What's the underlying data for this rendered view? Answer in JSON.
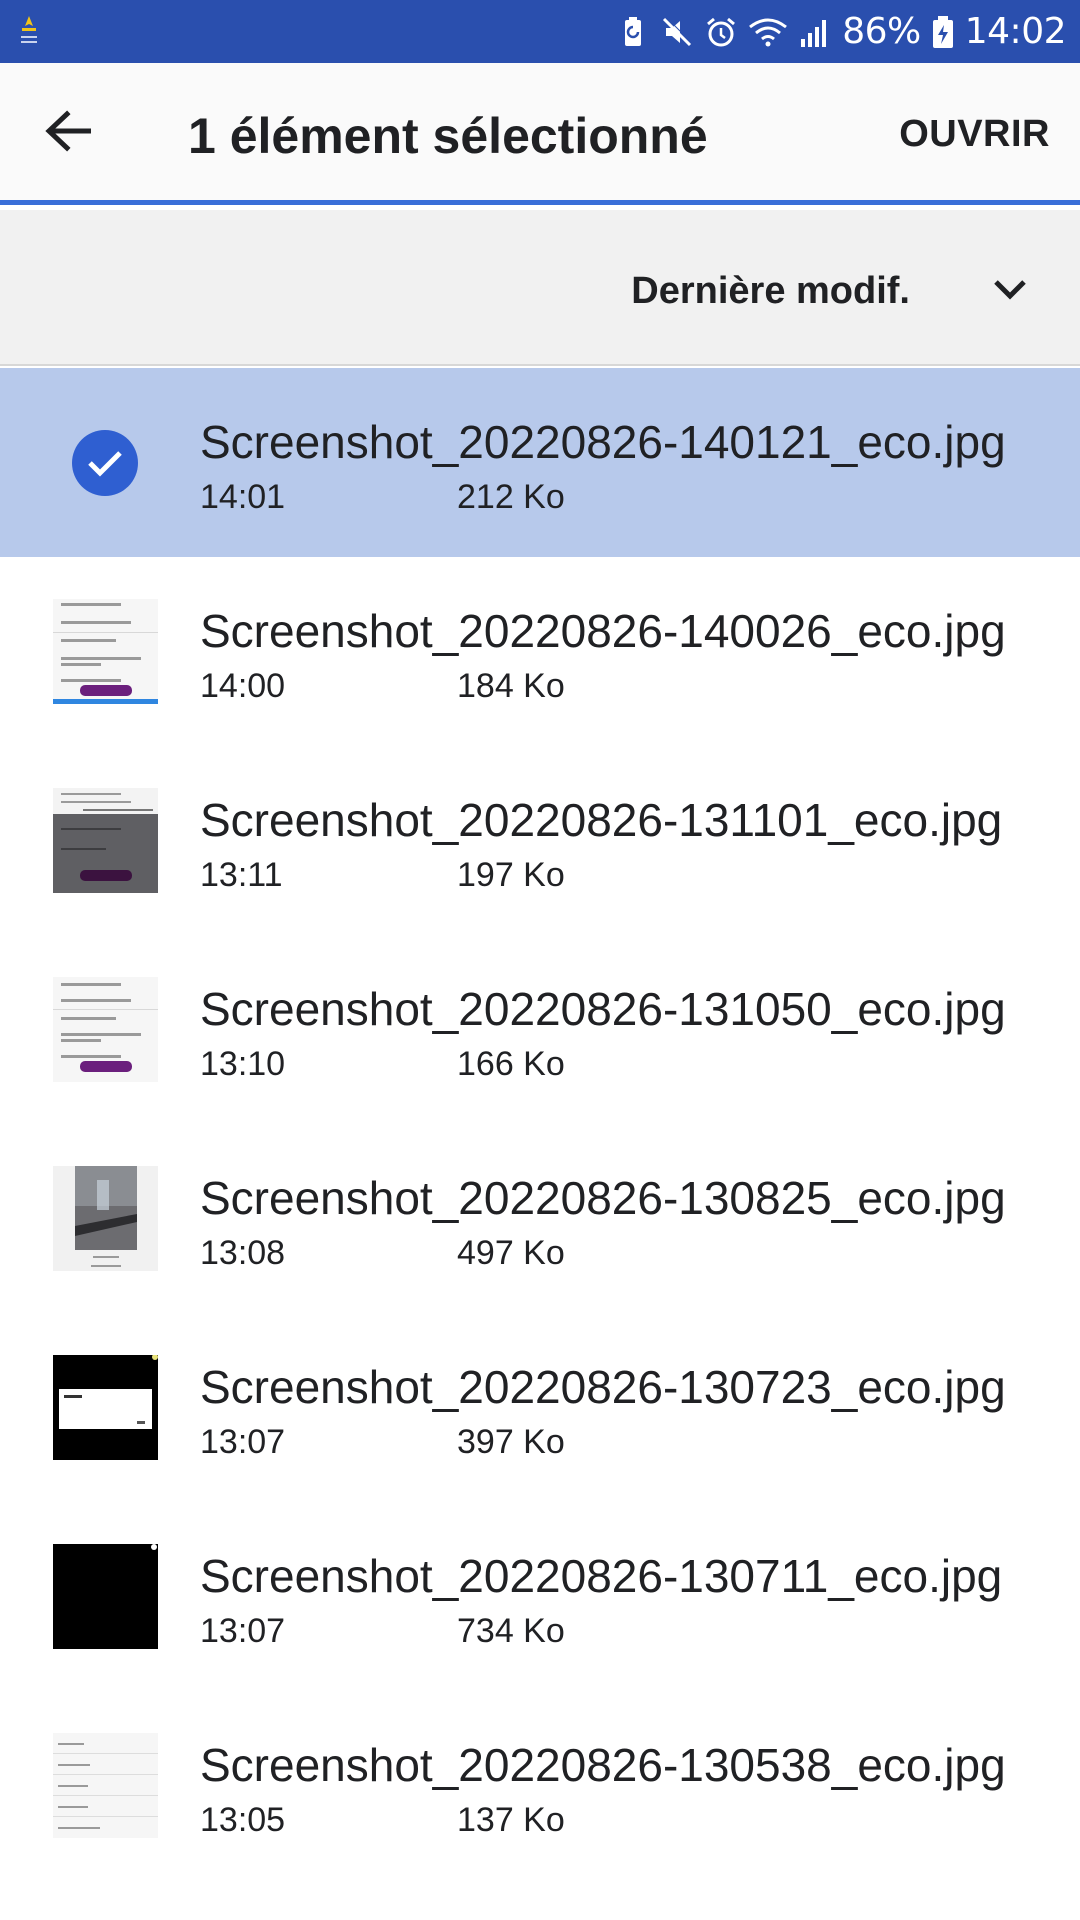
{
  "status_bar": {
    "battery_percent": "86%",
    "time": "14:02",
    "icons": [
      "app-notification-icon",
      "battery-saver-icon",
      "mute-icon",
      "alarm-icon",
      "wifi-icon",
      "signal-icon",
      "battery-charging-icon"
    ]
  },
  "app_bar": {
    "title": "1 élément sélectionné",
    "open_label": "OUVRIR"
  },
  "sort_bar": {
    "label": "Dernière modif."
  },
  "colors": {
    "status_bar": "#2a4fae",
    "accent_line": "#3a6fd8",
    "selected_row": "#b7c9eb",
    "check": "#2f5fd1"
  },
  "files": [
    {
      "name": "Screenshot_20220826-140121_eco.jpg",
      "time": "14:01",
      "size": "212 Ko",
      "selected": true,
      "thumbnail": "selected-check"
    },
    {
      "name": "Screenshot_20220826-140026_eco.jpg",
      "time": "14:00",
      "size": "184 Ko",
      "selected": false,
      "thumbnail": "form-light"
    },
    {
      "name": "Screenshot_20220826-131101_eco.jpg",
      "time": "13:11",
      "size": "197 Ko",
      "selected": false,
      "thumbnail": "form-dark"
    },
    {
      "name": "Screenshot_20220826-131050_eco.jpg",
      "time": "13:10",
      "size": "166 Ko",
      "selected": false,
      "thumbnail": "form-light"
    },
    {
      "name": "Screenshot_20220826-130825_eco.jpg",
      "time": "13:08",
      "size": "497 Ko",
      "selected": false,
      "thumbnail": "photo"
    },
    {
      "name": "Screenshot_20220826-130723_eco.jpg",
      "time": "13:07",
      "size": "397 Ko",
      "selected": false,
      "thumbnail": "dialog-black"
    },
    {
      "name": "Screenshot_20220826-130711_eco.jpg",
      "time": "13:07",
      "size": "734 Ko",
      "selected": false,
      "thumbnail": "black"
    },
    {
      "name": "Screenshot_20220826-130538_eco.jpg",
      "time": "13:05",
      "size": "137 Ko",
      "selected": false,
      "thumbnail": "list-light"
    }
  ]
}
